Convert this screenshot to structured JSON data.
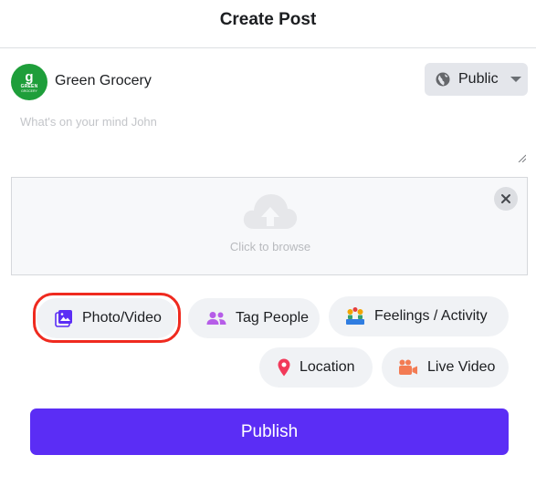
{
  "header": {
    "title": "Create Post"
  },
  "account": {
    "name": "Green Grocery",
    "avatar_mark": "g",
    "avatar_text": "GREEN",
    "avatar_subtext": "GROCERY",
    "avatar_color": "#1e9e3a"
  },
  "privacy": {
    "label": "Public",
    "icon": "globe-icon"
  },
  "composer": {
    "placeholder": "What's on your mind John",
    "value": ""
  },
  "upload": {
    "label": "Click to browse",
    "icon": "cloud-upload-icon",
    "close_icon": "close-icon"
  },
  "actions": [
    {
      "label": "Photo/Video",
      "icon": "photo-icon",
      "color": "#5b2df5",
      "highlighted": true
    },
    {
      "label": "Tag People",
      "icon": "people-icon",
      "color": "#b65de8"
    },
    {
      "label": "Feelings / Activity",
      "icon": "feelings-icon",
      "color": "#f2a400"
    },
    {
      "label": "Location",
      "icon": "location-pin-icon",
      "color": "#f2395a"
    },
    {
      "label": "Live Video",
      "icon": "video-camera-icon",
      "color": "#f37b53"
    }
  ],
  "publish": {
    "label": "Publish",
    "color": "#5b2df5"
  },
  "highlight_color": "#ef2a1f"
}
